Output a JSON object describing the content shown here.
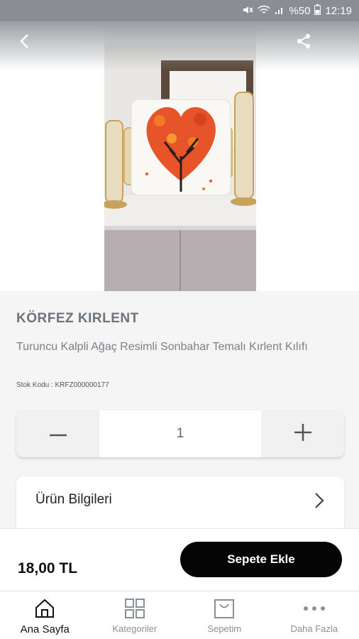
{
  "status_bar": {
    "battery": "%50",
    "time": "12:19"
  },
  "product": {
    "brand": "KÖRFEZ KIRLENT",
    "description": "Turuncu Kalpli Ağaç Resimli Sonbahar Temalı Kırlent Kılıfı",
    "stock_code": "Stok Kodu : KRFZ000000177",
    "quantity": "1",
    "info_label": "Ürün Bilgileri",
    "price": "18,00 TL",
    "add_to_cart": "Sepete Ekle"
  },
  "icons": {
    "back": "chevron-left-icon",
    "share": "share-icon",
    "minus": "minus-icon",
    "plus": "plus-icon",
    "chevron": "chevron-right-icon"
  },
  "nav": {
    "items": [
      {
        "label": "Ana Sayfa",
        "icon": "home-icon",
        "active": true
      },
      {
        "label": "Kategoriler",
        "icon": "grid-icon",
        "active": false
      },
      {
        "label": "Sepetim",
        "icon": "shopping-bag-icon",
        "active": false
      },
      {
        "label": "Daha Fazla",
        "icon": "more-icon",
        "active": false
      }
    ]
  },
  "colors": {
    "accent": "#050505",
    "status_bar": "#8a8e93",
    "brand_text": "#6d737a"
  }
}
